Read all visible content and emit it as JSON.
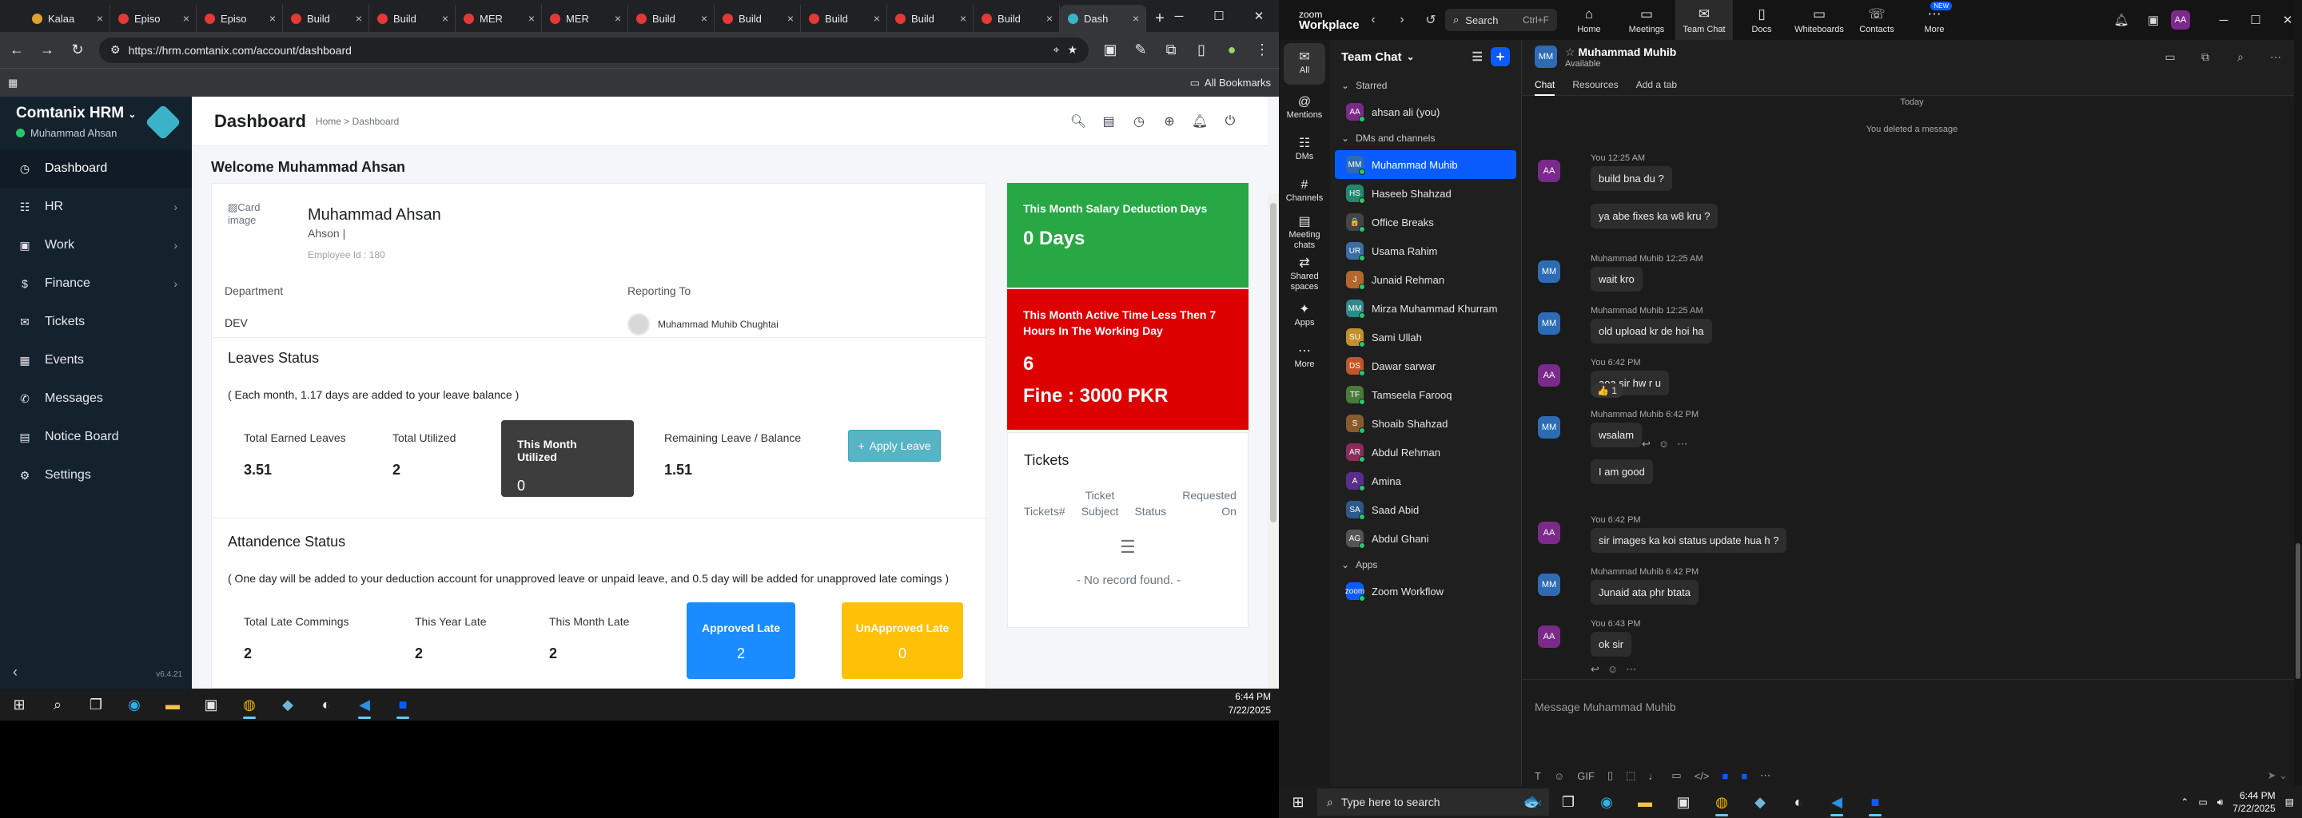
{
  "browser": {
    "tabs": [
      {
        "label": "Kalaa",
        "color": "#e0a030"
      },
      {
        "label": "Episo",
        "color": "#e53935"
      },
      {
        "label": "Episo",
        "color": "#e53935"
      },
      {
        "label": "Build",
        "color": "#e53935"
      },
      {
        "label": "Build",
        "color": "#e53935"
      },
      {
        "label": "MER",
        "color": "#e53935"
      },
      {
        "label": "MER",
        "color": "#e53935"
      },
      {
        "label": "Build",
        "color": "#e53935"
      },
      {
        "label": "Build",
        "color": "#e53935"
      },
      {
        "label": "Build",
        "color": "#e53935"
      },
      {
        "label": "Build",
        "color": "#e53935"
      },
      {
        "label": "Build",
        "color": "#e53935"
      },
      {
        "label": "Dash",
        "color": "#3ab3c8"
      }
    ],
    "url": "https://hrm.comtanix.com/account/dashboard",
    "bookmarks_label": "All Bookmarks"
  },
  "hrm": {
    "brand": "Comtanix HRM",
    "user": "Muhammad Ahsan",
    "version": "v6.4.21",
    "menu": [
      {
        "label": "Dashboard",
        "icon": "dashboard-icon",
        "chevron": false
      },
      {
        "label": "HR",
        "icon": "people-icon",
        "chevron": true
      },
      {
        "label": "Work",
        "icon": "briefcase-icon",
        "chevron": true
      },
      {
        "label": "Finance",
        "icon": "dollar-icon",
        "chevron": true
      },
      {
        "label": "Tickets",
        "icon": "ticket-icon",
        "chevron": false
      },
      {
        "label": "Events",
        "icon": "calendar-icon",
        "chevron": false
      },
      {
        "label": "Messages",
        "icon": "message-icon",
        "chevron": false
      },
      {
        "label": "Notice Board",
        "icon": "board-icon",
        "chevron": false
      },
      {
        "label": "Settings",
        "icon": "gear-icon",
        "chevron": false
      }
    ],
    "page_title": "Dashboard",
    "breadcrumb": "Home > Dashboard",
    "welcome": "Welcome Muhammad Ahsan",
    "profile": {
      "image_alt": "Card image",
      "name": "Muhammad Ahsan",
      "subtitle": "Ahson |",
      "employee_id": "Employee Id : 180",
      "department_label": "Department",
      "department": "DEV",
      "reporting_label": "Reporting To",
      "reporting_to": "Muhammad Muhib Chughtai"
    },
    "leaves": {
      "title": "Leaves Status",
      "note": "( Each month, 1.17 days are added to your leave balance )",
      "earned_label": "Total Earned Leaves",
      "earned": "3.51",
      "utilized_label": "Total Utilized",
      "utilized": "2",
      "month_label": "This Month Utilized",
      "month": "0",
      "remaining_label": "Remaining Leave / Balance",
      "remaining": "1.51",
      "apply_label": "Apply Leave"
    },
    "attendance": {
      "title": "Attandence Status",
      "note": "( One day will be added to your deduction account for unapproved leave or unpaid leave, and 0.5 day will be added for unapproved late comings )",
      "total_late_label": "Total Late Commings",
      "total_late": "2",
      "year_late_label": "This Year Late",
      "year_late": "2",
      "month_late_label": "This Month Late",
      "month_late": "2",
      "approved_label": "Approved Late",
      "approved": "2",
      "unapproved_label": "UnApproved Late",
      "unapproved": "0"
    },
    "salary": {
      "title": "This Month Salary Deduction Days",
      "value": "0 Days"
    },
    "active_time": {
      "title": "This Month Active Time Less Then 7 Hours In The Working Day",
      "value": "6",
      "fine": "Fine : 3000 PKR"
    },
    "tickets": {
      "title": "Tickets",
      "col1": "Tickets#",
      "col2a": "Ticket",
      "col2b": "Subject",
      "col3": "Status",
      "col4a": "Requested",
      "col4b": "On",
      "empty": "- No record found. -"
    }
  },
  "taskbar_left": {
    "time": "6:44 PM",
    "date": "7/22/2025"
  },
  "zoom": {
    "logo_top": "zoom",
    "logo_bottom": "Workplace",
    "search": "Search",
    "search_shortcut": "Ctrl+F",
    "tabs": [
      {
        "label": "Home",
        "icon": "home-icon"
      },
      {
        "label": "Meetings",
        "icon": "video-icon"
      },
      {
        "label": "Team Chat",
        "icon": "chat-icon"
      },
      {
        "label": "Docs",
        "icon": "doc-icon"
      },
      {
        "label": "Whiteboards",
        "icon": "whiteboard-icon"
      },
      {
        "label": "Contacts",
        "icon": "contacts-icon"
      },
      {
        "label": "More",
        "icon": "more-icon"
      }
    ],
    "new_badge": "NEW",
    "user_initials": "AA",
    "rail": [
      {
        "label": "All",
        "icon": "chat-bubble-icon"
      },
      {
        "label": "Mentions",
        "icon": "at-icon"
      },
      {
        "label": "DMs",
        "icon": "people-icon"
      },
      {
        "label": "Channels",
        "icon": "hash-icon"
      },
      {
        "label": "Meeting chats",
        "icon": "meeting-chat-icon"
      },
      {
        "label": "Shared spaces",
        "icon": "share-icon"
      },
      {
        "label": "Apps",
        "icon": "apps-icon"
      },
      {
        "label": "More",
        "icon": "more-icon"
      }
    ],
    "list_title": "Team Chat",
    "starred_label": "Starred",
    "starred": [
      {
        "name": "ahsan ali (you)",
        "initials": "AA",
        "color": "#7b2a8c"
      }
    ],
    "dm_label": "DMs and channels",
    "contacts": [
      {
        "name": "Muhammad Muhib",
        "initials": "MM",
        "color": "#2d6cb5"
      },
      {
        "name": "Haseeb Shahzad",
        "initials": "HS",
        "color": "#1f8a70"
      },
      {
        "name": "Office Breaks",
        "initials": "🔒",
        "color": "#444444"
      },
      {
        "name": "Usama Rahim",
        "initials": "UR",
        "color": "#3a6ea5"
      },
      {
        "name": "Junaid Rehman",
        "initials": "J",
        "color": "#b5662d"
      },
      {
        "name": "Mirza Muhammad Khurram",
        "initials": "MM",
        "color": "#2d8a8a"
      },
      {
        "name": "Sami Ullah",
        "initials": "SU",
        "color": "#c0902d"
      },
      {
        "name": "Dawar sarwar",
        "initials": "DS",
        "color": "#c0562d"
      },
      {
        "name": "Tamseela Farooq",
        "initials": "TF",
        "color": "#4a7a3a"
      },
      {
        "name": "Shoaib Shahzad",
        "initials": "S",
        "color": "#8a5a2d"
      },
      {
        "name": "Abdul Rehman",
        "initials": "AR",
        "color": "#8a2d5a"
      },
      {
        "name": "Amina",
        "initials": "A",
        "color": "#5a2d8a"
      },
      {
        "name": "Saad Abid",
        "initials": "SA",
        "color": "#2d5a8a"
      },
      {
        "name": "Abdul Ghani",
        "initials": "AG",
        "color": "#555555"
      }
    ],
    "apps_label": "Apps",
    "apps": [
      {
        "name": "Zoom Workflow",
        "initials": "zoom",
        "color": "#0b5cff"
      }
    ],
    "chat_name": "Muhammad Muhib",
    "chat_status": "Available",
    "chat_tabs": [
      "Chat",
      "Resources",
      "Add a tab"
    ],
    "today": "Today",
    "deleted": "You deleted a message",
    "messages": [
      {
        "meta": "You 12:25 AM",
        "text": "build bna du ?",
        "initials": "AA",
        "color": "#7b2a8c"
      },
      {
        "meta": "",
        "text": "ya abe fixes ka w8 kru ?",
        "initials": "",
        "color": ""
      },
      {
        "meta": "Muhammad Muhib 12:25 AM",
        "text": "wait kro",
        "initials": "MM",
        "color": "#2d6cb5"
      },
      {
        "meta": "Muhammad Muhib 12:25 AM",
        "text": "old upload kr de hoi ha",
        "initials": "MM",
        "color": "#2d6cb5"
      },
      {
        "meta": "You 6:42 PM",
        "text": "aoa sir hw r u",
        "initials": "AA",
        "color": "#7b2a8c"
      },
      {
        "meta": "Muhammad Muhib 6:42 PM",
        "text": "wsalam",
        "initials": "MM",
        "color": "#2d6cb5"
      },
      {
        "meta": "",
        "text": "I am good",
        "initials": "",
        "color": ""
      },
      {
        "meta": "You 6:42 PM",
        "text": "sir images ka koi status update hua h ?",
        "initials": "AA",
        "color": "#7b2a8c"
      },
      {
        "meta": "Muhammad Muhib 6:42 PM",
        "text": "Junaid ata phr btata",
        "initials": "MM",
        "color": "#2d6cb5"
      },
      {
        "meta": "You 6:43 PM",
        "text": "ok sir",
        "initials": "AA",
        "color": "#7b2a8c"
      }
    ],
    "reaction": "👍 1",
    "composer_placeholder": "Message Muhammad Muhib"
  },
  "taskbar_right": {
    "search": "Type here to search",
    "time": "6:44 PM",
    "date": "7/22/2025"
  }
}
